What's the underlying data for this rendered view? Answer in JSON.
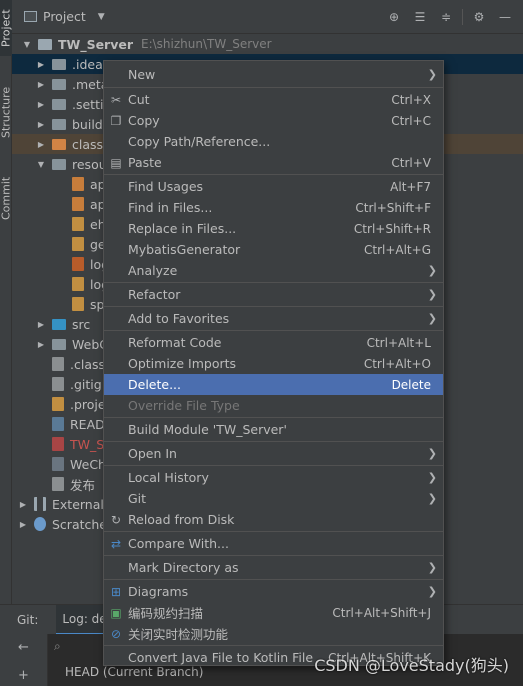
{
  "side_tabs": [
    "Project",
    "Structure",
    "Commit"
  ],
  "header": {
    "title": "Project",
    "icons": [
      "locate-icon",
      "expand-all-icon",
      "collapse-all-icon",
      "gear-icon",
      "minimize-icon"
    ]
  },
  "tree": {
    "root_name": "TW_Server",
    "root_path": "E:\\shizhun\\TW_Server",
    "rows": [
      ".idea",
      ".meta",
      ".setti",
      "build",
      "classe",
      "resou",
      "ap",
      "ap",
      "eh",
      "ge",
      "log",
      "log",
      "sp",
      "src",
      "WebC",
      ".class",
      ".gitig",
      ".proje",
      "READ",
      "TW_S",
      "WeCh",
      "发布",
      "External",
      "Scratche"
    ]
  },
  "bottom": {
    "git_label": "Git:",
    "log_tab": "Log: dev",
    "head_branch": "HEAD (Current Branch)"
  },
  "menu": {
    "items": [
      {
        "label": "New",
        "shortcut": "",
        "sub": true
      },
      {
        "label": "Cut",
        "shortcut": "Ctrl+X",
        "icon": "cut-icon"
      },
      {
        "label": "Copy",
        "shortcut": "Ctrl+C",
        "icon": "copy-icon"
      },
      {
        "label": "Copy Path/Reference...",
        "shortcut": ""
      },
      {
        "label": "Paste",
        "shortcut": "Ctrl+V",
        "icon": "paste-icon"
      },
      {
        "label": "Find Usages",
        "shortcut": "Alt+F7"
      },
      {
        "label": "Find in Files...",
        "shortcut": "Ctrl+Shift+F"
      },
      {
        "label": "Replace in Files...",
        "shortcut": "Ctrl+Shift+R"
      },
      {
        "label": "MybatisGenerator",
        "shortcut": "Ctrl+Alt+G"
      },
      {
        "label": "Analyze",
        "shortcut": "",
        "sub": true
      },
      {
        "label": "Refactor",
        "shortcut": "",
        "sub": true
      },
      {
        "label": "Add to Favorites",
        "shortcut": "",
        "sub": true
      },
      {
        "label": "Reformat Code",
        "shortcut": "Ctrl+Alt+L"
      },
      {
        "label": "Optimize Imports",
        "shortcut": "Ctrl+Alt+O"
      },
      {
        "label": "Delete...",
        "shortcut": "Delete"
      },
      {
        "label": "Override File Type",
        "shortcut": ""
      },
      {
        "label": "Build Module 'TW_Server'",
        "shortcut": ""
      },
      {
        "label": "Open In",
        "shortcut": "",
        "sub": true
      },
      {
        "label": "Local History",
        "shortcut": "",
        "sub": true
      },
      {
        "label": "Git",
        "shortcut": "",
        "sub": true
      },
      {
        "label": "Reload from Disk",
        "shortcut": "",
        "icon": "reload-icon"
      },
      {
        "label": "Compare With...",
        "shortcut": "",
        "icon": "compare-icon"
      },
      {
        "label": "Mark Directory as",
        "shortcut": "",
        "sub": true
      },
      {
        "label": "Diagrams",
        "shortcut": "",
        "sub": true,
        "icon": "diagram-icon"
      },
      {
        "label": "编码规约扫描",
        "shortcut": "Ctrl+Alt+Shift+J",
        "icon": "scan-icon"
      },
      {
        "label": "关闭实时检测功能",
        "shortcut": "",
        "icon": "disable-icon"
      },
      {
        "label": "Convert Java File to Kotlin File",
        "shortcut": "Ctrl+Alt+Shift+K"
      }
    ]
  },
  "watermark": "CSDN @LoveStady(狗头)",
  "colors": {
    "selection": "#4b6eaf",
    "background": "#2b2b2b",
    "panel": "#3c3f41",
    "modified_red": "#c75450"
  }
}
